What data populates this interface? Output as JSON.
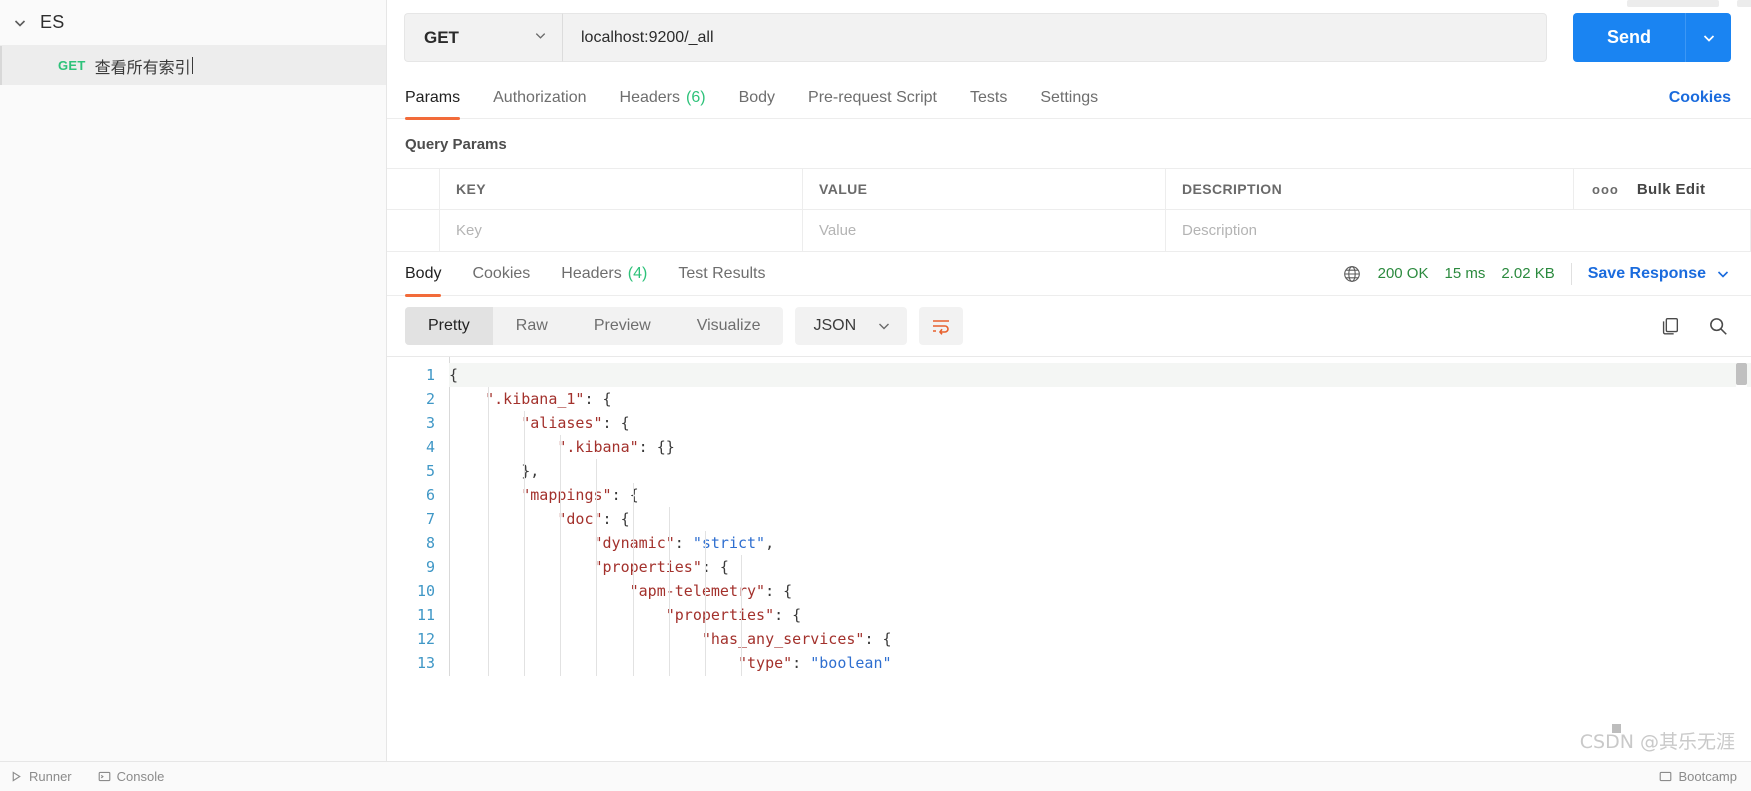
{
  "sidebar": {
    "collection": {
      "name": "ES",
      "chevron_icon": "chevron-down-icon"
    },
    "request": {
      "method": "GET",
      "name": "查看所有索引"
    },
    "footer": {
      "runner_label": "Runner",
      "console_label": "Console"
    }
  },
  "request_bar": {
    "method": "GET",
    "method_caret_icon": "chevron-down-icon",
    "url": "localhost:9200/_all",
    "send_label": "Send",
    "send_caret_icon": "chevron-down-icon"
  },
  "request_tabs": [
    {
      "label": "Params",
      "active": true
    },
    {
      "label": "Authorization",
      "active": false
    },
    {
      "label": "Headers",
      "count": "(6)",
      "active": false
    },
    {
      "label": "Body",
      "active": false
    },
    {
      "label": "Pre-request Script",
      "active": false
    },
    {
      "label": "Tests",
      "active": false
    },
    {
      "label": "Settings",
      "active": false
    }
  ],
  "cookies_link": "Cookies",
  "query_params": {
    "title": "Query Params",
    "headers": {
      "key": "KEY",
      "value": "VALUE",
      "description": "DESCRIPTION"
    },
    "tools": {
      "dots_icon": "more-options-icon",
      "dots_label": "ooo",
      "bulk_edit": "Bulk Edit"
    },
    "rows": [
      {
        "key_placeholder": "Key",
        "value_placeholder": "Value",
        "description_placeholder": "Description"
      }
    ]
  },
  "response_tabs": [
    {
      "label": "Body",
      "active": true
    },
    {
      "label": "Cookies",
      "active": false
    },
    {
      "label": "Headers",
      "count": "(4)",
      "active": false
    },
    {
      "label": "Test Results",
      "active": false
    }
  ],
  "response_status": {
    "globe_icon": "globe-icon",
    "status": "200 OK",
    "time": "15 ms",
    "size": "2.02 KB",
    "save_response": "Save Response",
    "save_caret_icon": "chevron-down-icon",
    "status_color": "#2b8a3e",
    "link_color": "#1a6bdd"
  },
  "view_toolbar": {
    "modes": [
      {
        "label": "Pretty",
        "active": true
      },
      {
        "label": "Raw",
        "active": false
      },
      {
        "label": "Preview",
        "active": false
      },
      {
        "label": "Visualize",
        "active": false
      }
    ],
    "format": "JSON",
    "format_caret_icon": "chevron-down-icon",
    "wrap_icon": "word-wrap-icon",
    "copy_icon": "copy-icon",
    "search_icon": "search-icon"
  },
  "code": {
    "language": "json",
    "lines": [
      {
        "n": "1",
        "indent": 0,
        "tokens": [
          {
            "t": "{",
            "c": "p"
          }
        ]
      },
      {
        "n": "2",
        "indent": 1,
        "tokens": [
          {
            "t": "\".kibana_1\"",
            "c": "k"
          },
          {
            "t": ": {",
            "c": "p"
          }
        ]
      },
      {
        "n": "3",
        "indent": 2,
        "tokens": [
          {
            "t": "\"aliases\"",
            "c": "k"
          },
          {
            "t": ": {",
            "c": "p"
          }
        ]
      },
      {
        "n": "4",
        "indent": 3,
        "tokens": [
          {
            "t": "\".kibana\"",
            "c": "k"
          },
          {
            "t": ": {}",
            "c": "p"
          }
        ]
      },
      {
        "n": "5",
        "indent": 2,
        "tokens": [
          {
            "t": "},",
            "c": "p"
          }
        ]
      },
      {
        "n": "6",
        "indent": 2,
        "tokens": [
          {
            "t": "\"mappings\"",
            "c": "k"
          },
          {
            "t": ": {",
            "c": "p"
          }
        ]
      },
      {
        "n": "7",
        "indent": 3,
        "tokens": [
          {
            "t": "\"doc\"",
            "c": "k"
          },
          {
            "t": ": {",
            "c": "p"
          }
        ]
      },
      {
        "n": "8",
        "indent": 4,
        "tokens": [
          {
            "t": "\"dynamic\"",
            "c": "k"
          },
          {
            "t": ": ",
            "c": "p"
          },
          {
            "t": "\"strict\"",
            "c": "s"
          },
          {
            "t": ",",
            "c": "p"
          }
        ]
      },
      {
        "n": "9",
        "indent": 4,
        "tokens": [
          {
            "t": "\"properties\"",
            "c": "k"
          },
          {
            "t": ": {",
            "c": "p"
          }
        ]
      },
      {
        "n": "10",
        "indent": 5,
        "tokens": [
          {
            "t": "\"apm-telemetry\"",
            "c": "k"
          },
          {
            "t": ": {",
            "c": "p"
          }
        ]
      },
      {
        "n": "11",
        "indent": 6,
        "tokens": [
          {
            "t": "\"properties\"",
            "c": "k"
          },
          {
            "t": ": {",
            "c": "p"
          }
        ]
      },
      {
        "n": "12",
        "indent": 7,
        "tokens": [
          {
            "t": "\"has_any_services\"",
            "c": "k"
          },
          {
            "t": ": {",
            "c": "p"
          }
        ]
      },
      {
        "n": "13",
        "indent": 8,
        "tokens": [
          {
            "t": "\"type\"",
            "c": "k"
          },
          {
            "t": ": ",
            "c": "p"
          },
          {
            "t": "\"boolean\"",
            "c": "s"
          }
        ]
      }
    ]
  },
  "statusbar": {
    "runner": "Runner",
    "console": "Console",
    "bootcamp": "Bootcamp"
  },
  "watermark": {
    "text": "CSDN @其乐无涯"
  }
}
